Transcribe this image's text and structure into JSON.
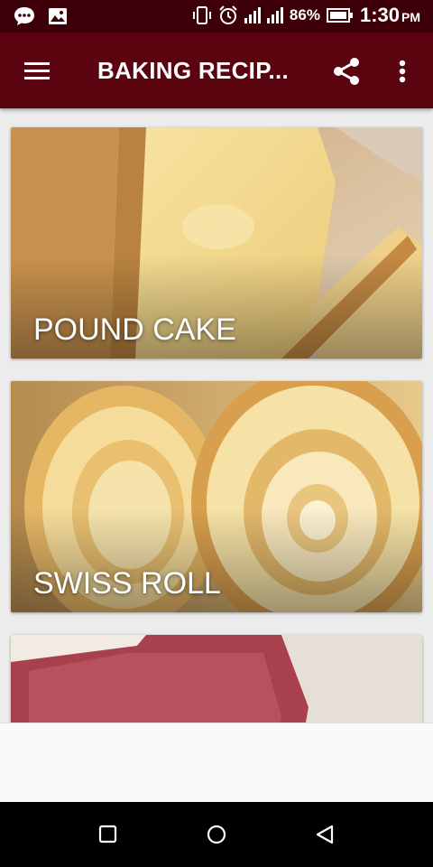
{
  "status_bar": {
    "battery": "86%",
    "time": "1:30",
    "time_suffix": "PM"
  },
  "app_bar": {
    "title": "BAKING RECIP..."
  },
  "recipes": [
    {
      "label": "POUND CAKE"
    },
    {
      "label": "SWISS ROLL"
    },
    {
      "label": ""
    }
  ],
  "colors": {
    "status_bar": "#3d0008",
    "app_bar": "#5a0410",
    "background": "#ececec"
  },
  "icons": {
    "menu": "hamburger-menu-icon",
    "share": "share-icon",
    "more": "more-vert-icon",
    "nav_recents": "square-recents-icon",
    "nav_home": "circle-home-icon",
    "nav_back": "triangle-back-icon"
  }
}
